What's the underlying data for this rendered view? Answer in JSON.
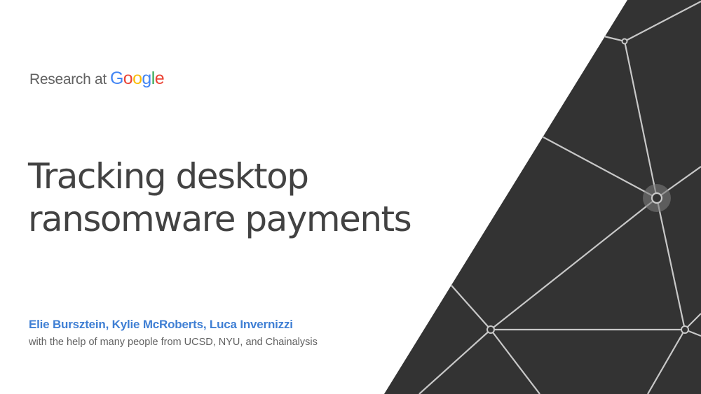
{
  "header": {
    "prefix": "Research at",
    "logo_text": "Google",
    "logo_colors": [
      "#4285F4",
      "#EA4335",
      "#FBBC05",
      "#4285F4",
      "#34A853",
      "#EA4335"
    ]
  },
  "title": {
    "line1": "Tracking desktop",
    "line2": "ransomware payments"
  },
  "authors": "Elie Bursztein, Kylie McRoberts, Luca Invernizzi",
  "credit": "with the help of many people from  UCSD, NYU, and Chainalysis",
  "colors": {
    "background": "#ffffff",
    "panel": "#333333",
    "network_lines": "#c8c8c8",
    "accent": "#3f7fd4"
  }
}
